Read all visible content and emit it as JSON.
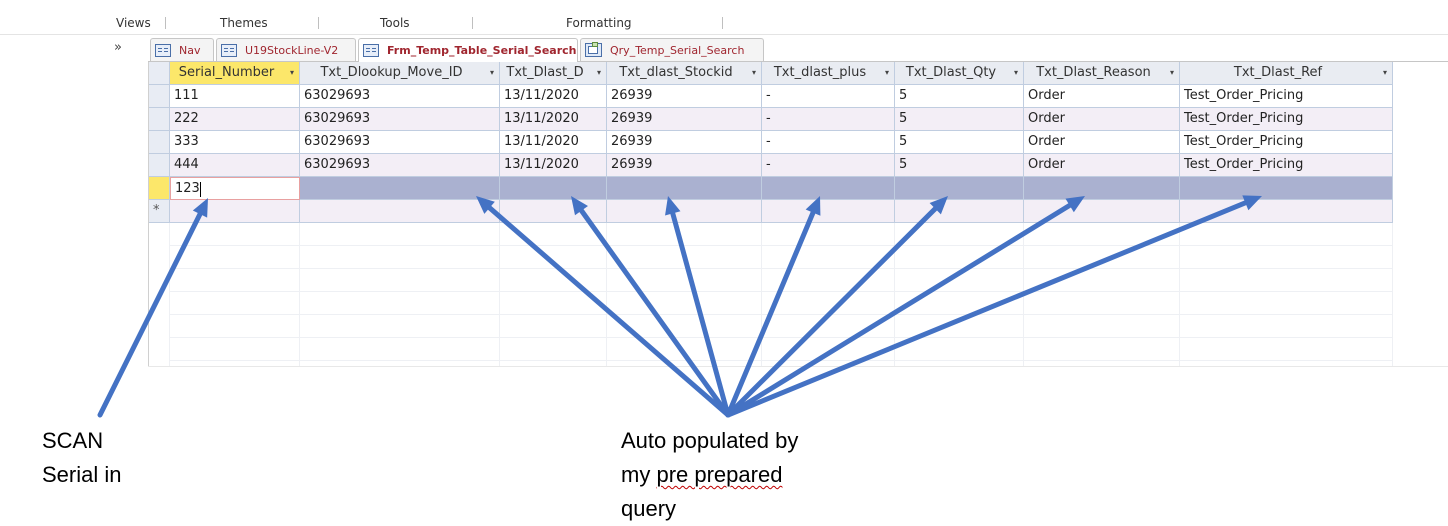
{
  "ribbon": {
    "groups": [
      "Views",
      "Themes",
      "Tools",
      "Formatting"
    ]
  },
  "nav": {
    "chevron": "»"
  },
  "tabs": [
    {
      "label": "Nav",
      "icon": "form-icon",
      "active": false
    },
    {
      "label": "U19StockLine-V2",
      "icon": "form-icon",
      "active": false
    },
    {
      "label": "Frm_Temp_Table_Serial_Search",
      "icon": "form-icon",
      "active": true
    },
    {
      "label": "Qry_Temp_Serial_Search",
      "icon": "query-icon",
      "active": false
    }
  ],
  "datasheet": {
    "columns": [
      "Serial_Number",
      "Txt_Dlookup_Move_ID",
      "Txt_Dlast_D",
      "Txt_dlast_Stockid",
      "Txt_dlast_plus",
      "Txt_Dlast_Qty",
      "Txt_Dlast_Reason",
      "Txt_Dlast_Ref"
    ],
    "rows": [
      [
        "111",
        "63029693",
        "13/11/2020",
        "26939",
        "-",
        "5",
        "Order",
        "Test_Order_Pricing"
      ],
      [
        "222",
        "63029693",
        "13/11/2020",
        "26939",
        "-",
        "5",
        "Order",
        "Test_Order_Pricing"
      ],
      [
        "333",
        "63029693",
        "13/11/2020",
        "26939",
        "-",
        "5",
        "Order",
        "Test_Order_Pricing"
      ],
      [
        "444",
        "63029693",
        "13/11/2020",
        "26939",
        "-",
        "5",
        "Order",
        "Test_Order_Pricing"
      ]
    ],
    "current_row_value": "123",
    "new_record_marker": "*",
    "dropdown_glyph": "▾"
  },
  "annotations": {
    "left": {
      "line1": "SCAN",
      "line2": "Serial in"
    },
    "right": {
      "line1": "Auto populated by",
      "line2_a": "my",
      "line2_b": "pre prepared",
      "line3": "query"
    },
    "arrow_color": "#4472c4"
  }
}
